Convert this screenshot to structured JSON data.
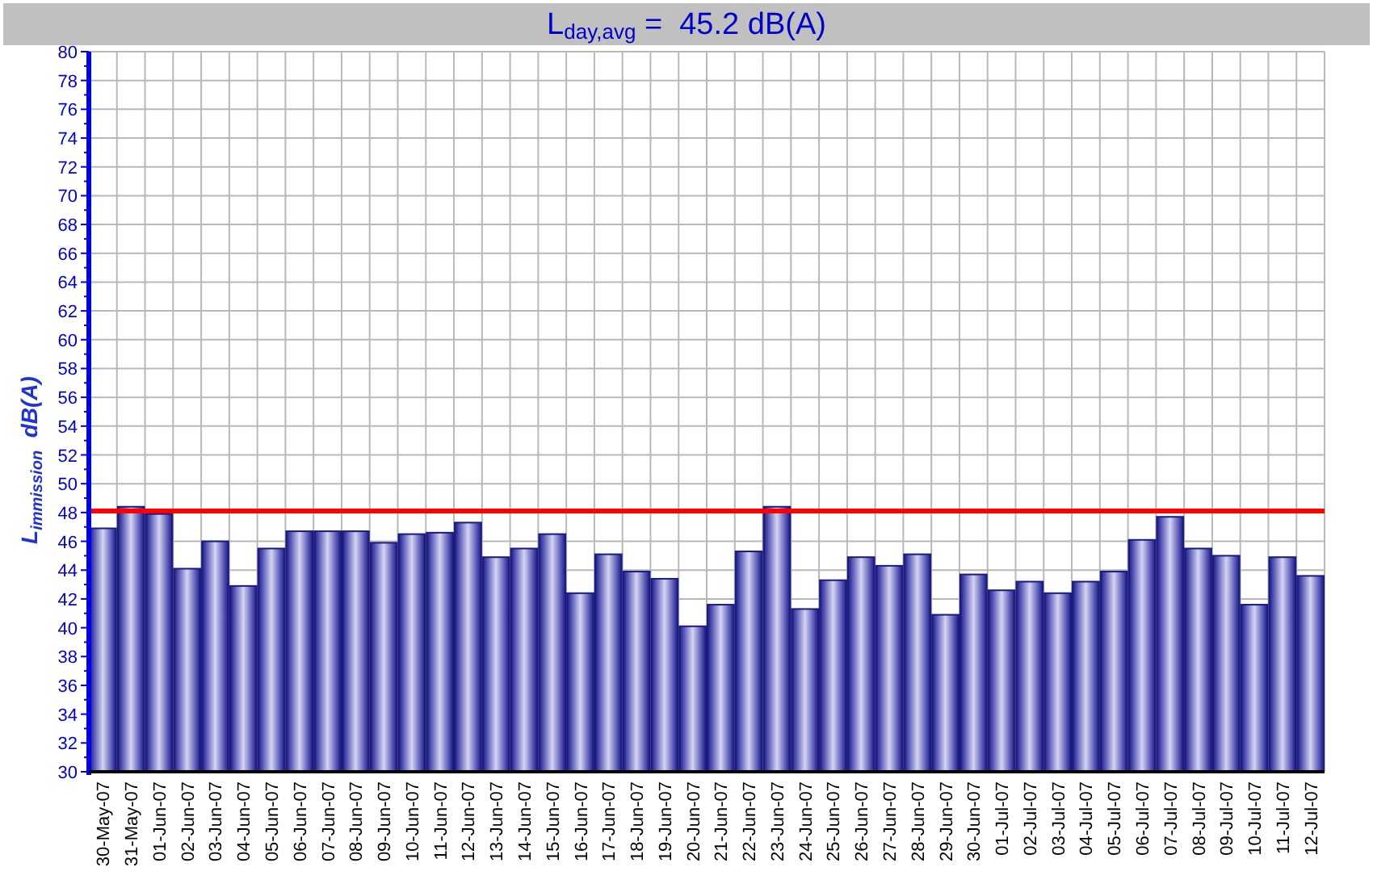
{
  "chart_data": {
    "type": "bar",
    "title": "L$_{day,avg}$ =  45.2 dB(A)",
    "ylabel": "L$_{immission}$  dB(A)",
    "categories": [
      "30-May-07",
      "31-May-07",
      "01-Jun-07",
      "02-Jun-07",
      "03-Jun-07",
      "04-Jun-07",
      "05-Jun-07",
      "06-Jun-07",
      "07-Jun-07",
      "08-Jun-07",
      "09-Jun-07",
      "10-Jun-07",
      "11-Jun-07",
      "12-Jun-07",
      "13-Jun-07",
      "14-Jun-07",
      "15-Jun-07",
      "16-Jun-07",
      "17-Jun-07",
      "18-Jun-07",
      "19-Jun-07",
      "20-Jun-07",
      "21-Jun-07",
      "22-Jun-07",
      "23-Jun-07",
      "24-Jun-07",
      "25-Jun-07",
      "26-Jun-07",
      "27-Jun-07",
      "28-Jun-07",
      "29-Jun-07",
      "30-Jun-07",
      "01-Jul-07",
      "02-Jul-07",
      "03-Jul-07",
      "04-Jul-07",
      "05-Jul-07",
      "06-Jul-07",
      "07-Jul-07",
      "08-Jul-07",
      "09-Jul-07",
      "10-Jul-07",
      "11-Jul-07",
      "12-Jul-07"
    ],
    "series": [
      {
        "color": "#1a1a80",
        "values": [
          46.9,
          48.4,
          47.9,
          44.1,
          46.0,
          42.9,
          45.5,
          46.7,
          46.7,
          46.7,
          45.9,
          46.5,
          46.6,
          47.3,
          44.9,
          45.5,
          46.5,
          42.4,
          45.1,
          43.9,
          43.4,
          40.1,
          41.6,
          45.3,
          48.4,
          41.3,
          43.3,
          44.9,
          44.3,
          45.1,
          40.9,
          43.7,
          42.6,
          43.2,
          42.4,
          43.2,
          43.9,
          46.1,
          47.7,
          45.5,
          45.0,
          41.6,
          44.9,
          43.6
        ]
      }
    ],
    "ylim": [
      30,
      80
    ],
    "yticks": [
      30,
      32,
      34,
      36,
      38,
      40,
      42,
      44,
      46,
      48,
      50,
      52,
      54,
      56,
      58,
      60,
      62,
      64,
      66,
      68,
      70,
      72,
      74,
      76,
      78,
      80
    ],
    "grid": true,
    "ref_lines": [
      {
        "axis": "y",
        "value": 48.1,
        "color": "#ff0000"
      }
    ]
  }
}
